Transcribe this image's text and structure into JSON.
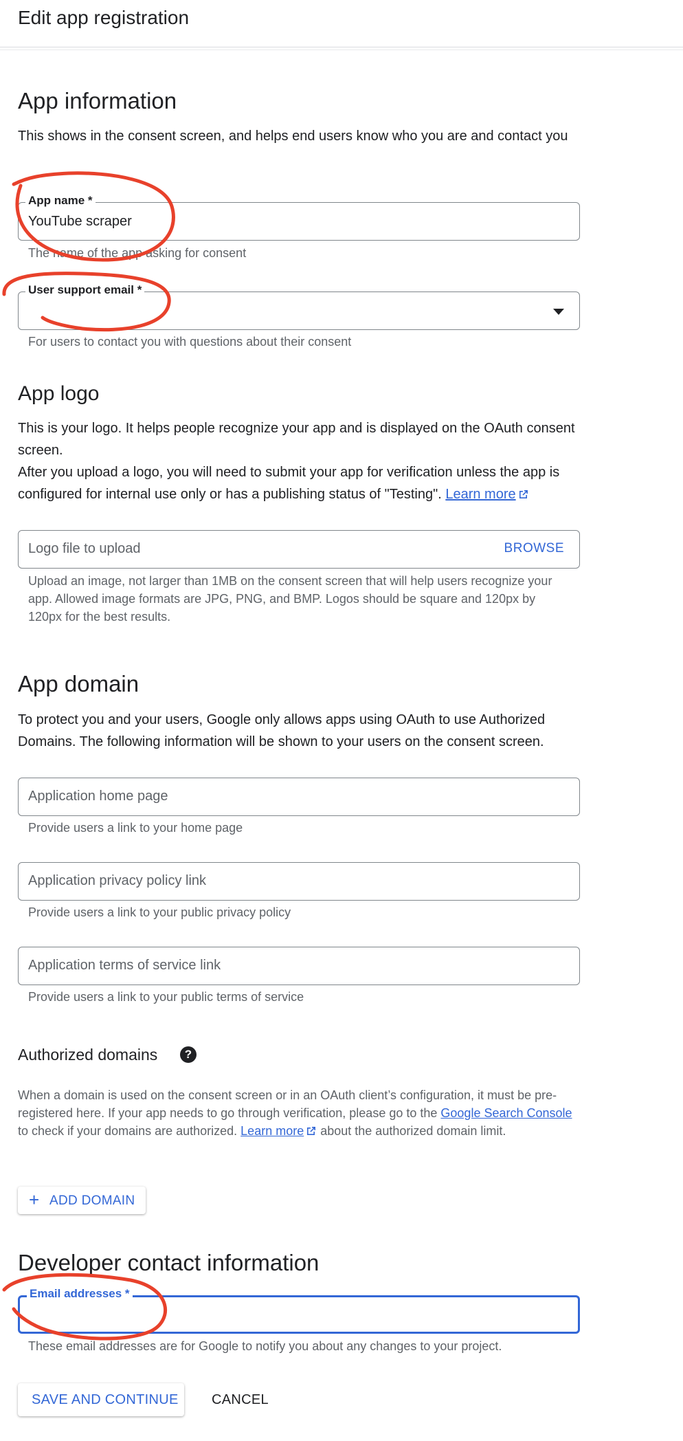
{
  "header": {
    "title": "Edit app registration"
  },
  "app_info": {
    "heading": "App information",
    "description": "This shows in the consent screen, and helps end users know who you are and contact you",
    "app_name": {
      "label": "App name *",
      "value": "YouTube scraper",
      "helper": "The name of the app asking for consent"
    },
    "support_email": {
      "label": "User support email *",
      "value": "",
      "helper": "For users to contact you with questions about their consent"
    }
  },
  "app_logo": {
    "heading": "App logo",
    "line1": "This is your logo. It helps people recognize your app and is displayed on the OAuth consent screen.",
    "line2": "After you upload a logo, you will need to submit your app for verification unless the app is configured for internal use only or has a publishing status of \"Testing\".",
    "learn_more": "Learn more",
    "upload_placeholder": "Logo file to upload",
    "browse_label": "BROWSE",
    "helper": "Upload an image, not larger than 1MB on the consent screen that will help users recognize your app. Allowed image formats are JPG, PNG, and BMP. Logos should be square and 120px by 120px for the best results."
  },
  "app_domain": {
    "heading": "App domain",
    "description": "To protect you and your users, Google only allows apps using OAuth to use Authorized Domains. The following information will be shown to your users on the consent screen.",
    "home_page": {
      "placeholder": "Application home page",
      "helper": "Provide users a link to your home page"
    },
    "privacy": {
      "placeholder": "Application privacy policy link",
      "helper": "Provide users a link to your public privacy policy"
    },
    "terms": {
      "placeholder": "Application terms of service link",
      "helper": "Provide users a link to your public terms of service"
    }
  },
  "authorized_domains": {
    "heading": "Authorized domains",
    "help_icon": "?",
    "text_a": "When a domain is used on the consent screen or in an OAuth client’s configuration, it must be pre-registered here. If your app needs to go through verification, please go to the ",
    "link_console": "Google Search Console",
    "text_b": " to check if your domains are authorized. ",
    "learn_more": "Learn more",
    "text_c": " about the authorized domain limit.",
    "add_button": "ADD DOMAIN"
  },
  "developer_contact": {
    "heading": "Developer contact information",
    "email": {
      "label": "Email addresses *",
      "value": "",
      "helper": "These email addresses are for Google to notify you about any changes to your project."
    }
  },
  "actions": {
    "save": "SAVE AND CONTINUE",
    "cancel": "CANCEL"
  },
  "colors": {
    "accent": "#3367d6",
    "annotation": "#e8412b",
    "text": "#202124",
    "muted": "#5f6368"
  },
  "icons": {
    "dropdown": "caret-down-icon",
    "external": "external-link-icon",
    "help": "help-icon",
    "add": "plus-icon"
  }
}
